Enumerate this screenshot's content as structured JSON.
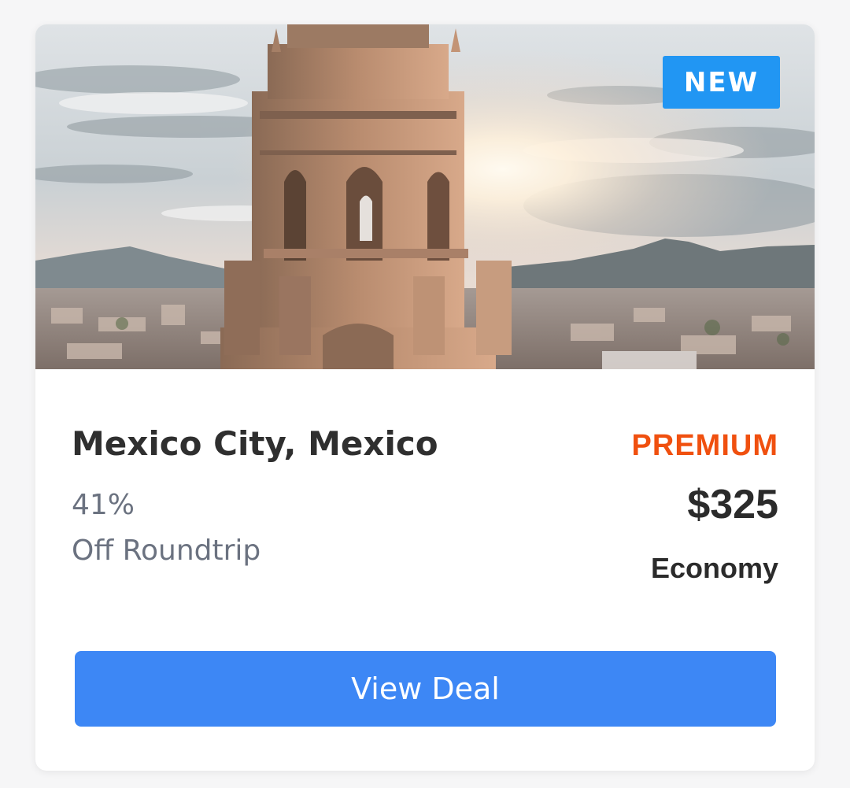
{
  "deal": {
    "badge": "NEW",
    "destination": "Mexico City, Mexico",
    "discount_percent": "41%",
    "discount_label": "Off Roundtrip",
    "tier": "PREMIUM",
    "price": "$325",
    "cabin": "Economy",
    "cta_label": "View Deal"
  },
  "colors": {
    "badge_bg": "#2196f3",
    "tier_text": "#f0500f",
    "cta_bg": "#3d87f5",
    "title_text": "#2f2f2f",
    "muted_text": "#6b7280"
  },
  "icons": {
    "hero_image": "bell-tower-city-sunset-photo"
  }
}
